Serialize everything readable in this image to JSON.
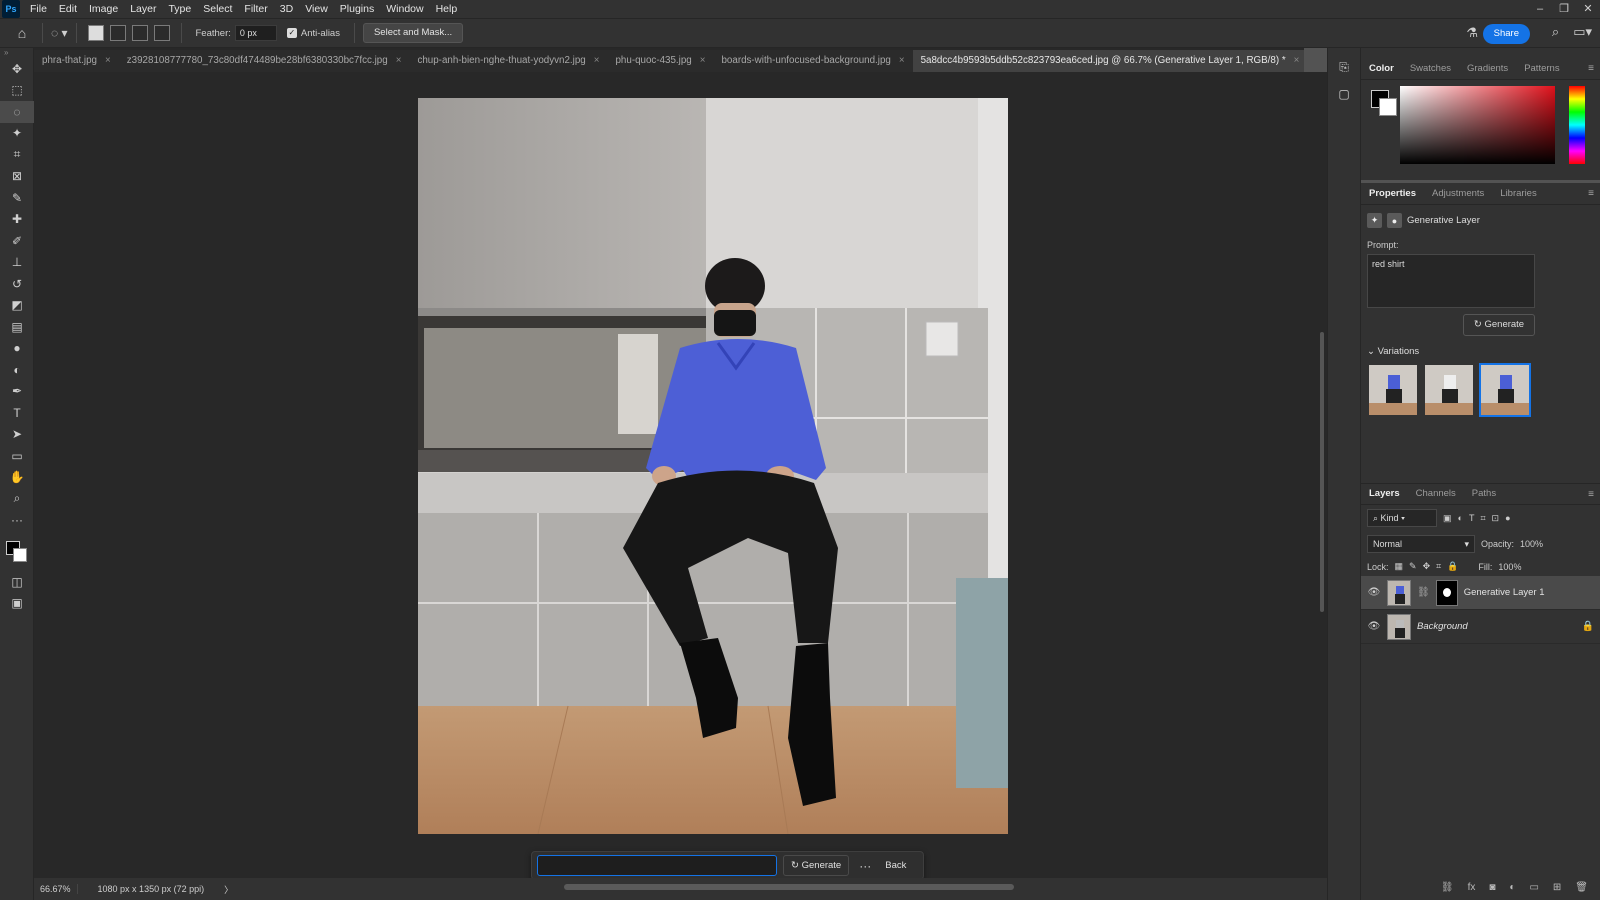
{
  "app": {
    "logo": "Ps"
  },
  "menu": [
    "File",
    "Edit",
    "Image",
    "Layer",
    "Type",
    "Select",
    "Filter",
    "3D",
    "View",
    "Plugins",
    "Window",
    "Help"
  ],
  "window_controls": [
    "–",
    "❐",
    "✕"
  ],
  "options": {
    "feather_label": "Feather:",
    "feather_value": "0 px",
    "antialias_label": "Anti-alias",
    "select_mask_label": "Select and Mask...",
    "share_label": "Share"
  },
  "tabs": [
    {
      "label": "phra-that.jpg"
    },
    {
      "label": "z3928108777780_73c80df474489be28bf6380330bc7fcc.jpg"
    },
    {
      "label": "chup-anh-bien-nghe-thuat-yodyvn2.jpg"
    },
    {
      "label": "phu-quoc-435.jpg"
    },
    {
      "label": "boards-with-unfocused-background.jpg"
    },
    {
      "label": "5a8dcc4b9593b5ddb52c823793ea6ced.jpg @ 66.7% (Generative Layer 1, RGB/8) *"
    }
  ],
  "status": {
    "zoom": "66.67%",
    "dimensions": "1080 px x 1350 px (72 ppi)"
  },
  "context_bar": {
    "input_value": "",
    "generate_label": "Generate",
    "more_label": "···",
    "back_label": "Back"
  },
  "color_panel": {
    "tabs": [
      "Color",
      "Swatches",
      "Gradients",
      "Patterns"
    ],
    "foreground": "#000000",
    "background": "#ffffff"
  },
  "properties": {
    "tabs": [
      "Properties",
      "Adjustments",
      "Libraries"
    ],
    "layer_type": "Generative Layer",
    "prompt_label": "Prompt:",
    "prompt_value": "red shirt",
    "generate_label": "Generate",
    "variations_label": "Variations",
    "variation_count": 3,
    "selected_variation": 3
  },
  "layers_panel": {
    "tabs": [
      "Layers",
      "Channels",
      "Paths"
    ],
    "filter_label": "Kind",
    "blend_mode": "Normal",
    "opacity_label": "Opacity:",
    "opacity_value": "100%",
    "lock_label": "Lock:",
    "fill_label": "Fill:",
    "fill_value": "100%",
    "layers": [
      {
        "name": "Generative Layer 1",
        "active": true
      },
      {
        "name": "Background",
        "active": false,
        "locked": true
      }
    ]
  }
}
